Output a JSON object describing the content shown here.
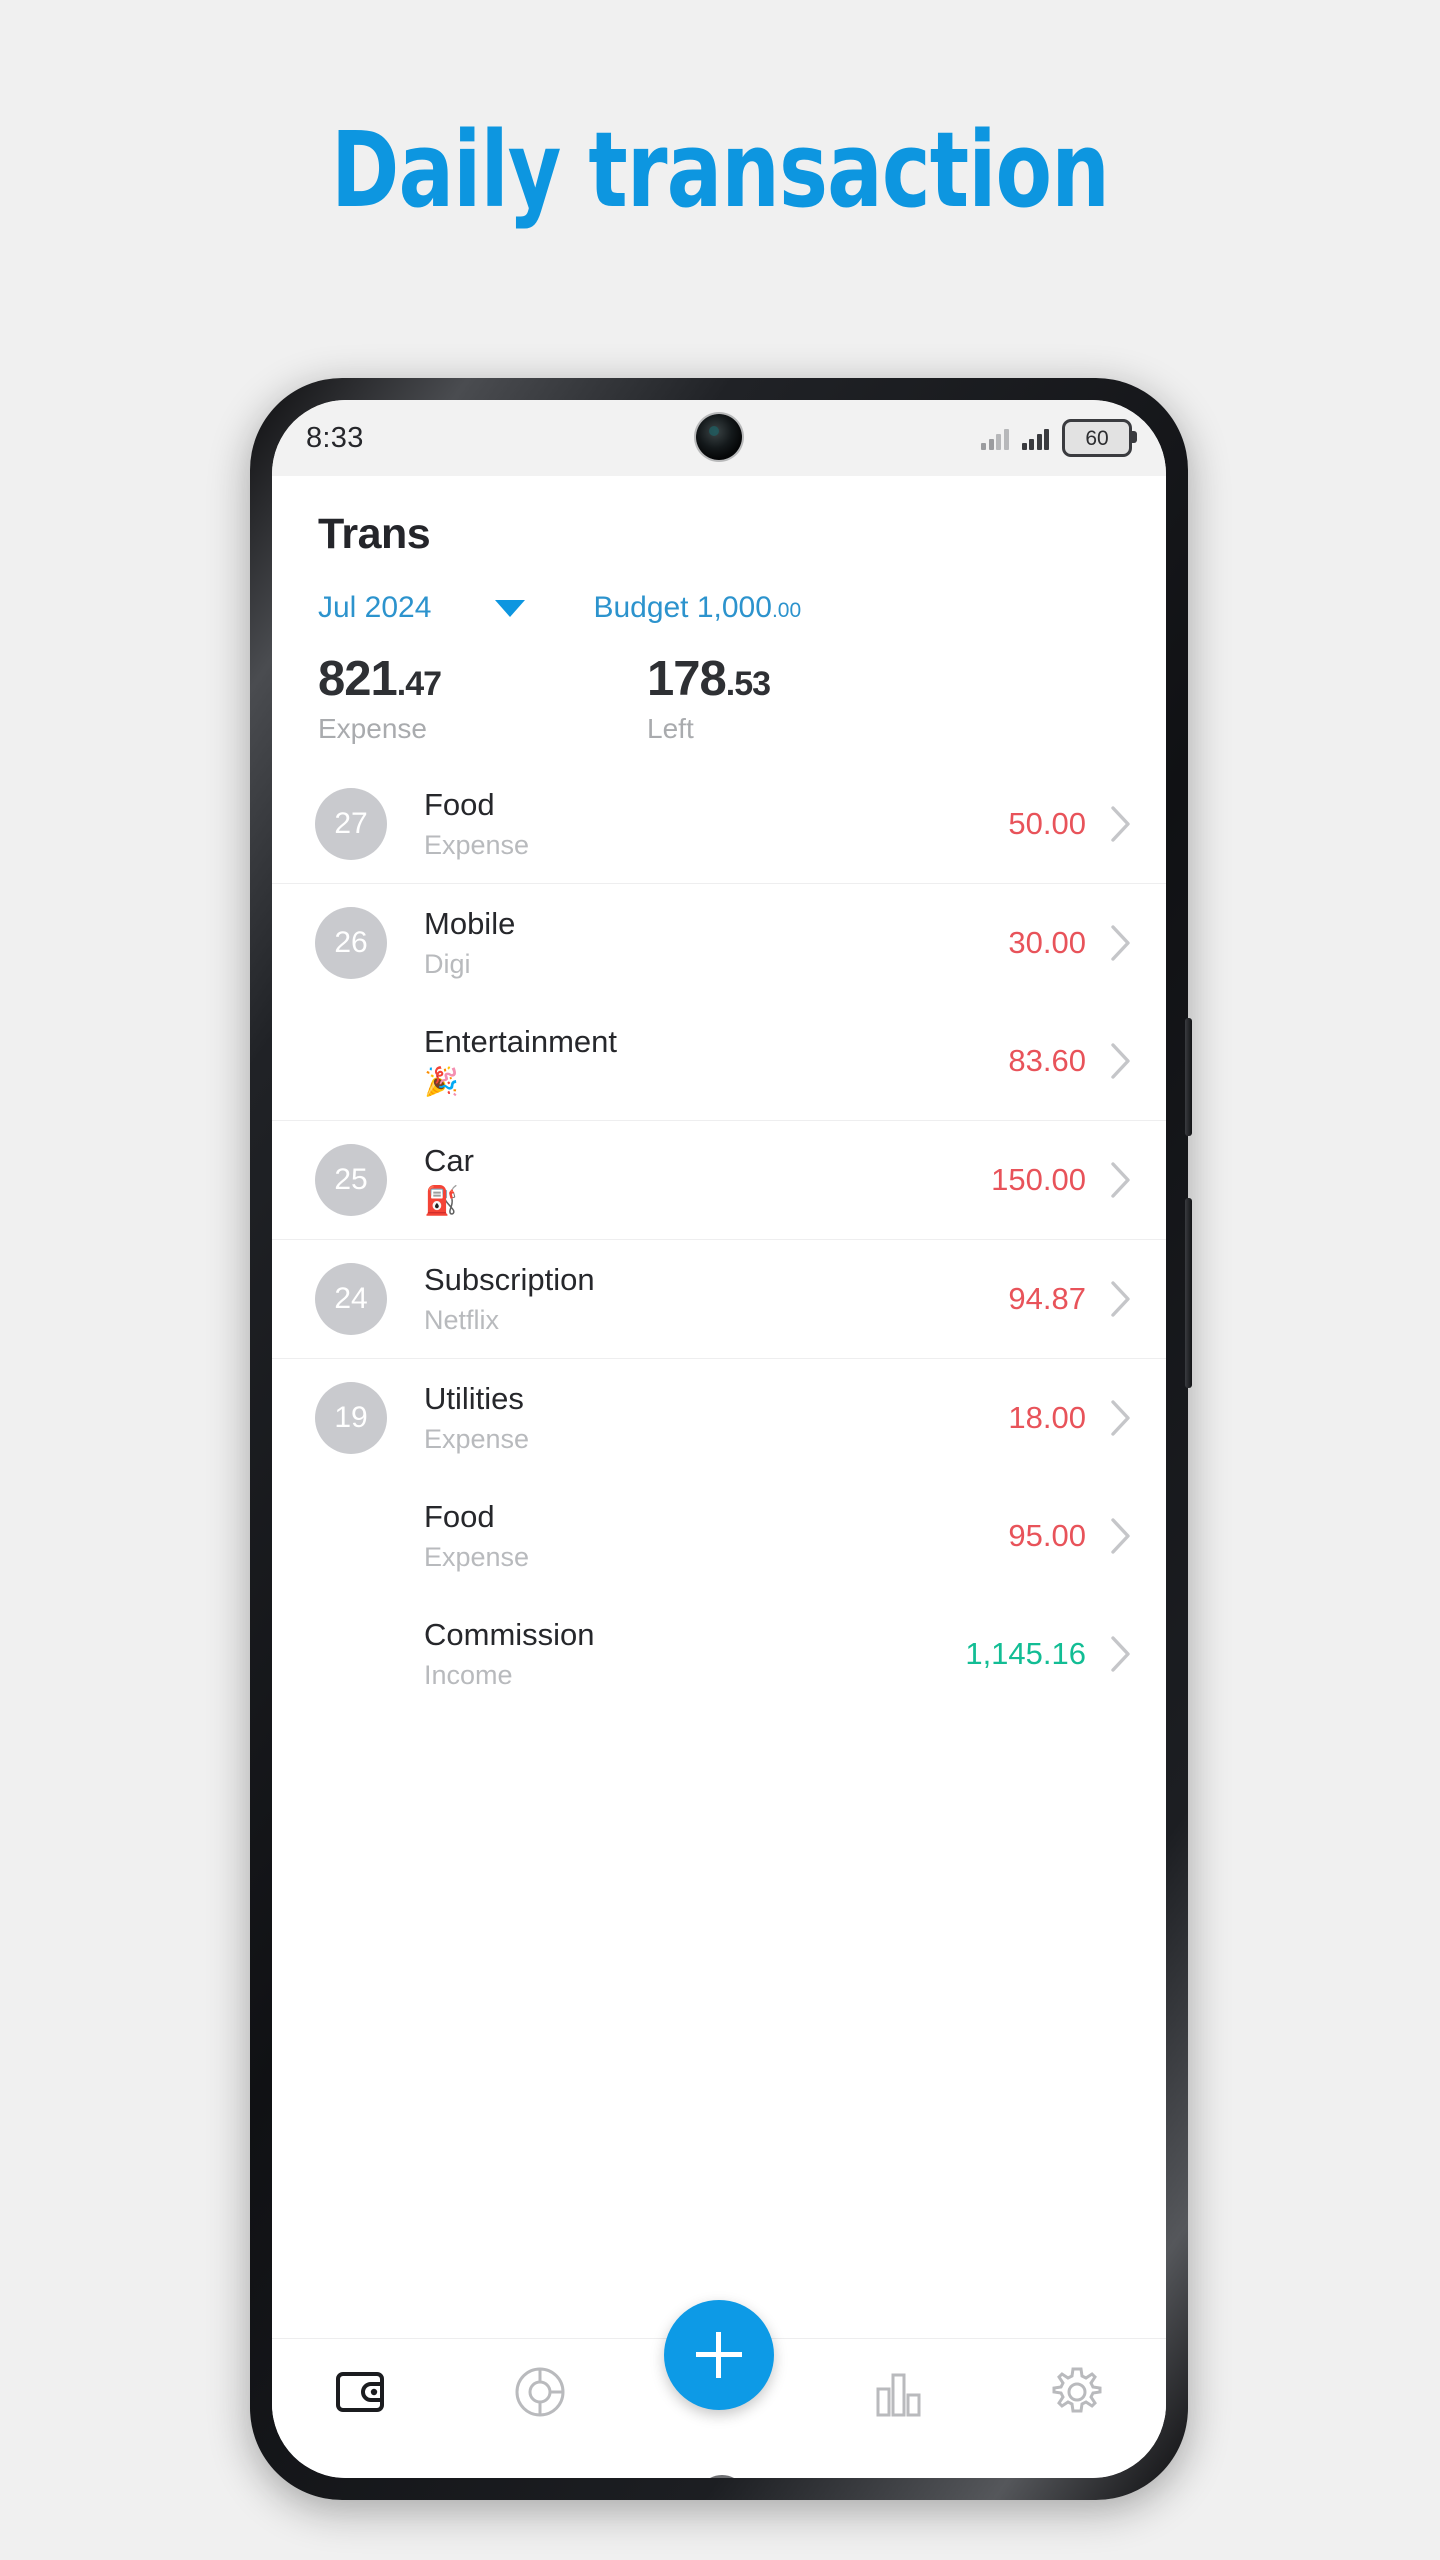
{
  "promo": {
    "title": "Daily transaction",
    "accent_color": "#0d96e0"
  },
  "status_bar": {
    "time": "8:33",
    "battery_level": "60",
    "signal_icon": "signal-bars-icon",
    "battery_icon": "battery-icon",
    "camera_icon": "front-camera-icon"
  },
  "app": {
    "title": "Trans",
    "selector": {
      "month": "Jul 2024",
      "dropdown_icon": "chevron-down-icon",
      "budget_label": "Budget 1,000",
      "budget_cents": ".00"
    },
    "totals": [
      {
        "value": "821",
        "cents": ".47",
        "label": "Expense"
      },
      {
        "value": "178",
        "cents": ".53",
        "label": "Left"
      }
    ],
    "groups": [
      {
        "day": "27",
        "rows": [
          {
            "day": "27",
            "title": "Food",
            "sub": "Expense",
            "sub_is_emoji": false,
            "amount": "50.00",
            "kind": "expense"
          }
        ]
      },
      {
        "day": "26",
        "rows": [
          {
            "day": "26",
            "title": "Mobile",
            "sub": "Digi",
            "sub_is_emoji": false,
            "amount": "30.00",
            "kind": "expense"
          },
          {
            "day": "",
            "title": "Entertainment",
            "sub": "🎉",
            "sub_is_emoji": true,
            "amount": "83.60",
            "kind": "expense"
          }
        ]
      },
      {
        "day": "25",
        "rows": [
          {
            "day": "25",
            "title": "Car",
            "sub": "⛽",
            "sub_is_emoji": true,
            "amount": "150.00",
            "kind": "expense"
          }
        ]
      },
      {
        "day": "24",
        "rows": [
          {
            "day": "24",
            "title": "Subscription",
            "sub": "Netflix",
            "sub_is_emoji": false,
            "amount": "94.87",
            "kind": "expense"
          }
        ]
      },
      {
        "day": "19",
        "rows": [
          {
            "day": "19",
            "title": "Utilities",
            "sub": "Expense",
            "sub_is_emoji": false,
            "amount": "18.00",
            "kind": "expense"
          },
          {
            "day": "",
            "title": "Food",
            "sub": "Expense",
            "sub_is_emoji": false,
            "amount": "95.00",
            "kind": "expense"
          },
          {
            "day": "",
            "title": "Commission",
            "sub": "Income",
            "sub_is_emoji": false,
            "amount": "1,145.16",
            "kind": "income"
          }
        ]
      }
    ],
    "colors": {
      "expense": "#e8535a",
      "income": "#12bd94",
      "accent": "#0d9ae6",
      "link": "#2c93cd"
    },
    "bottom_nav": [
      {
        "name": "wallet-icon",
        "active": true
      },
      {
        "name": "donut-chart-icon",
        "active": false
      },
      {
        "name": "bar-chart-icon",
        "active": false
      },
      {
        "name": "gear-icon",
        "active": false
      }
    ],
    "fab": {
      "icon": "plus-icon",
      "label": "+"
    }
  },
  "android_nav": [
    {
      "name": "recents-button"
    },
    {
      "name": "home-button"
    },
    {
      "name": "back-button"
    }
  ]
}
